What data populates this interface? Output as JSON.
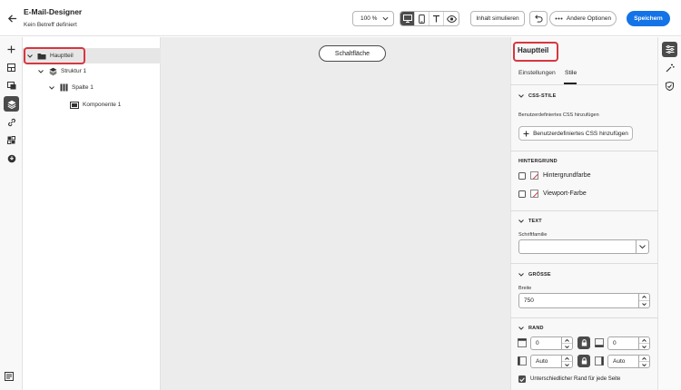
{
  "header": {
    "title": "E-Mail-Designer",
    "subtitle": "Kein Betreff definiert",
    "zoom_value": "100 %",
    "simulate_label": "Inhalt simulieren",
    "more_label": "Andere Optionen",
    "save_label": "Speichern",
    "view_modes": [
      "desktop-icon",
      "mobile-icon",
      "text-icon",
      "preview-eye-icon"
    ],
    "active_view": "desktop-icon"
  },
  "left_toolbar": {
    "items": [
      "add-icon",
      "layout-icon",
      "assets-icon",
      "layers-icon",
      "link-icon",
      "fragments-icon",
      "personalization-icon"
    ],
    "active": "layers-icon",
    "bottom": "settings-stack-icon"
  },
  "tree": {
    "nodes": [
      {
        "label": "Hauptteil"
      },
      {
        "label": "Struktur 1"
      },
      {
        "label": "Spalte 1"
      },
      {
        "label": "Komponente 1"
      }
    ]
  },
  "canvas": {
    "button_label": "Schaltfläche"
  },
  "right_panel": {
    "title": "Hauptteil",
    "tabs": [
      "Einstellungen",
      "Stile"
    ],
    "active_tab": "Stile",
    "css": {
      "heading": "CSS-STILE",
      "hint": "Benutzerdefiniertes CSS hinzufügen",
      "button": "Benutzerdefiniertes CSS hinzufügen"
    },
    "background": {
      "heading": "HINTERGRUND",
      "items": [
        "Hintergrundfarbe",
        "Viewport-Farbe"
      ]
    },
    "text": {
      "heading": "TEXT",
      "font_family_label": "Schriftfamilie",
      "font_family_value": ""
    },
    "size": {
      "heading": "GRÖSSE",
      "width_label": "Breite",
      "width_value": "750"
    },
    "border": {
      "heading": "RAND",
      "top": "0",
      "bottom": "0",
      "left": "Auto",
      "right": "Auto",
      "different_label": "Unterschiedlicher Rand für jede Seite",
      "different_checked": true
    }
  },
  "right_rail": {
    "items": [
      "properties-icon",
      "magic-wand-icon",
      "validation-icon"
    ],
    "active": "properties-icon"
  },
  "colors": {
    "accent": "#1473e6",
    "highlight": "#d7373f",
    "active_tool": "#4b4b4b"
  }
}
